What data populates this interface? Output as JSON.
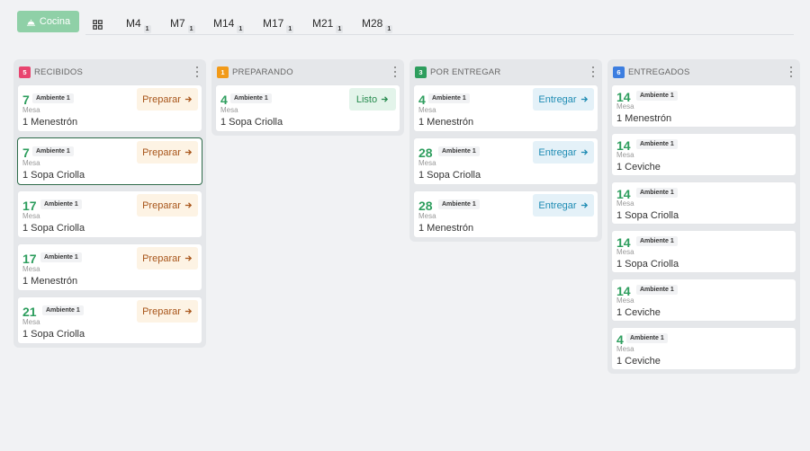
{
  "topbar": {
    "kitchen_label": "Cocina",
    "tabs": [
      {
        "label": "M4",
        "count": "1"
      },
      {
        "label": "M7",
        "count": "1"
      },
      {
        "label": "M14",
        "count": "1"
      },
      {
        "label": "M17",
        "count": "1"
      },
      {
        "label": "M21",
        "count": "1"
      },
      {
        "label": "M28",
        "count": "1"
      }
    ]
  },
  "colors": {
    "recibidos": "#e8446f",
    "preparando": "#f29a18",
    "por_entregar": "#2e9e5e",
    "entregados": "#3d7ee0"
  },
  "columns": [
    {
      "title": "RECIBIDOS",
      "count": "5",
      "action": "Preparar",
      "cards": [
        {
          "num": "7",
          "amb": "Ambiente 1",
          "mesa": "Mesa",
          "item": "1 Menestrón"
        },
        {
          "num": "7",
          "amb": "Ambiente 1",
          "mesa": "Mesa",
          "item": "1 Sopa Criolla"
        },
        {
          "num": "17",
          "amb": "Ambiente 1",
          "mesa": "Mesa",
          "item": "1 Sopa Criolla"
        },
        {
          "num": "17",
          "amb": "Ambiente 1",
          "mesa": "Mesa",
          "item": "1 Menestrón"
        },
        {
          "num": "21",
          "amb": "Ambiente 1",
          "mesa": "Mesa",
          "item": "1 Sopa Criolla"
        }
      ]
    },
    {
      "title": "PREPARANDO",
      "count": "1",
      "action": "Listo",
      "cards": [
        {
          "num": "4",
          "amb": "Ambiente 1",
          "mesa": "Mesa",
          "item": "1 Sopa Criolla"
        }
      ]
    },
    {
      "title": "POR ENTREGAR",
      "count": "3",
      "action": "Entregar",
      "cards": [
        {
          "num": "4",
          "amb": "Ambiente 1",
          "mesa": "Mesa",
          "item": "1 Menestrón"
        },
        {
          "num": "28",
          "amb": "Ambiente 1",
          "mesa": "Mesa",
          "item": "1 Sopa Criolla"
        },
        {
          "num": "28",
          "amb": "Ambiente 1",
          "mesa": "Mesa",
          "item": "1 Menestrón"
        }
      ]
    },
    {
      "title": "ENTREGADOS",
      "count": "6",
      "cards": [
        {
          "num": "14",
          "amb": "Ambiente 1",
          "mesa": "Mesa",
          "item": "1 Menestrón"
        },
        {
          "num": "14",
          "amb": "Ambiente 1",
          "mesa": "Mesa",
          "item": "1 Ceviche"
        },
        {
          "num": "14",
          "amb": "Ambiente 1",
          "mesa": "Mesa",
          "item": "1 Sopa Criolla"
        },
        {
          "num": "14",
          "amb": "Ambiente 1",
          "mesa": "Mesa",
          "item": "1 Sopa Criolla"
        },
        {
          "num": "14",
          "amb": "Ambiente 1",
          "mesa": "Mesa",
          "item": "1 Ceviche"
        },
        {
          "num": "4",
          "amb": "Ambiente 1",
          "mesa": "Mesa",
          "item": "1 Ceviche"
        }
      ]
    }
  ]
}
